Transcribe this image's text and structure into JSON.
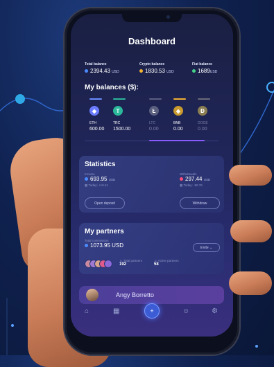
{
  "dashboard": {
    "title": "Dashboard"
  },
  "balances": [
    {
      "label": "Total balance",
      "value": "2394.43",
      "unit": "USD",
      "color": "#4a8cff"
    },
    {
      "label": "Crypto balance",
      "value": "1830.53",
      "unit": "USD",
      "color": "#f2b233"
    },
    {
      "label": "Fiat balance",
      "value": "1689",
      "unit": "USD",
      "color": "#46d18a"
    }
  ],
  "my_balances": {
    "title": "My balances ($):",
    "coins": [
      {
        "symbol": "ETH",
        "amount": "600.00",
        "icon": "ethereum-icon",
        "glyph": "◆",
        "color": "#6a7bff",
        "bar": "#6a8cff",
        "active": true
      },
      {
        "symbol": "TRC",
        "amount": "1500.00",
        "icon": "tron-icon",
        "glyph": "T",
        "color": "#2bb89b",
        "bar": "#2bb89b",
        "active": true
      },
      {
        "symbol": "LTC",
        "amount": "0.00",
        "icon": "litecoin-icon",
        "glyph": "Ł",
        "color": "#5a5f80",
        "bar": "#5a5f80",
        "active": false
      },
      {
        "symbol": "BNB",
        "amount": "0.00",
        "icon": "binance-icon",
        "glyph": "◈",
        "color": "#c99a2e",
        "bar": "#f2b233",
        "active": false
      },
      {
        "symbol": "DOGE",
        "amount": "0.00",
        "icon": "dogecoin-icon",
        "glyph": "Ð",
        "color": "#8a7d52",
        "bar": "#6b6b7a",
        "active": false
      }
    ]
  },
  "statistics": {
    "title": "Statistics",
    "income": {
      "label": "Income",
      "value": "693.95",
      "unit": "USD",
      "today": "Today: +10.41",
      "color": "#4a8cff"
    },
    "withdrawals": {
      "label": "Withdrawals",
      "value": "297.44",
      "unit": "USD",
      "today": "Today: -90.76",
      "color": "#ff4d7a"
    },
    "open_deposit_label": "Open deposit",
    "withdraw_label": "Withdraw"
  },
  "partners": {
    "title": "My partners",
    "total_label": "Total commission",
    "total_value": "1073.95 USD",
    "invite_label": "Invite",
    "total_partners_label": "Total partners",
    "total_partners": "192",
    "active_partners_label": "Active partners",
    "active_partners": "58"
  },
  "profile": {
    "name": "Angy Borretto"
  },
  "nav": {
    "icons": [
      "home-icon",
      "grid-icon",
      "plus-icon",
      "user-icon",
      "settings-icon"
    ]
  }
}
